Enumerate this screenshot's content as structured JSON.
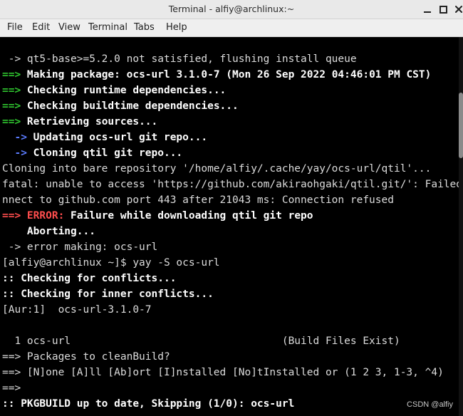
{
  "window": {
    "title": "Terminal - alfiy@archlinux:~"
  },
  "menu": [
    "File",
    "Edit",
    "View",
    "Terminal",
    "Tabs",
    "Help"
  ],
  "colors": {
    "arrow_green": "#2fc52f",
    "arrow_blue": "#5b7cff",
    "error_red": "#ff4d4d",
    "text": "#dcdcdc",
    "background": "#000000"
  },
  "terminal": {
    "lines": [
      {
        "segs": [
          {
            "t": " -> qt5-base>=5.2.0 not satisfied, flushing install queue",
            "c": ""
          }
        ]
      },
      {
        "segs": [
          {
            "t": "==>",
            "c": "g"
          },
          {
            "t": " Making package: ocs-url 3.1.0-7 (Mon 26 Sep 2022 04:46:01 PM CST)",
            "c": "w"
          }
        ]
      },
      {
        "segs": [
          {
            "t": "==>",
            "c": "g"
          },
          {
            "t": " Checking runtime dependencies...",
            "c": "w"
          }
        ]
      },
      {
        "segs": [
          {
            "t": "==>",
            "c": "g"
          },
          {
            "t": " Checking buildtime dependencies...",
            "c": "w"
          }
        ]
      },
      {
        "segs": [
          {
            "t": "==>",
            "c": "g"
          },
          {
            "t": " Retrieving sources...",
            "c": "w"
          }
        ]
      },
      {
        "segs": [
          {
            "t": "  ->",
            "c": "b"
          },
          {
            "t": " Updating ocs-url git repo...",
            "c": "w"
          }
        ]
      },
      {
        "segs": [
          {
            "t": "  ->",
            "c": "b"
          },
          {
            "t": " Cloning qtil git repo...",
            "c": "w"
          }
        ]
      },
      {
        "segs": [
          {
            "t": "Cloning into bare repository '/home/alfiy/.cache/yay/ocs-url/qtil'...",
            "c": ""
          }
        ]
      },
      {
        "segs": [
          {
            "t": "fatal: unable to access 'https://github.com/akiraohgaki/qtil.git/': Failed to co",
            "c": ""
          }
        ]
      },
      {
        "segs": [
          {
            "t": "nnect to github.com port 443 after 21043 ms: Connection refused",
            "c": ""
          }
        ]
      },
      {
        "segs": [
          {
            "t": "==>",
            "c": "r"
          },
          {
            "t": " ERROR:",
            "c": "r"
          },
          {
            "t": " Failure while downloading qtil git repo",
            "c": "w"
          }
        ]
      },
      {
        "segs": [
          {
            "t": "    Aborting...",
            "c": "w"
          }
        ]
      },
      {
        "segs": [
          {
            "t": " -> error making: ocs-url",
            "c": ""
          }
        ]
      },
      {
        "segs": [
          {
            "t": "[alfiy@archlinux ~]$ yay -S ocs-url",
            "c": ""
          }
        ]
      },
      {
        "segs": [
          {
            "t": ":: Checking for conflicts...",
            "c": "w"
          }
        ]
      },
      {
        "segs": [
          {
            "t": ":: Checking for inner conflicts...",
            "c": "w"
          }
        ]
      },
      {
        "segs": [
          {
            "t": "[Aur:1]  ocs-url-3.1.0-7",
            "c": ""
          }
        ]
      },
      {
        "segs": [
          {
            "t": "",
            "c": ""
          }
        ]
      },
      {
        "segs": [
          {
            "t": "  1 ocs-url                                  (Build Files Exist)",
            "c": ""
          }
        ]
      },
      {
        "segs": [
          {
            "t": "==> Packages to cleanBuild?",
            "c": ""
          }
        ]
      },
      {
        "segs": [
          {
            "t": "==> [N]one [A]ll [Ab]ort [I]nstalled [No]tInstalled or (1 2 3, 1-3, ^4)",
            "c": ""
          }
        ]
      },
      {
        "segs": [
          {
            "t": "==>",
            "c": ""
          }
        ]
      },
      {
        "segs": [
          {
            "t": ":: PKGBUILD up to date, Skipping (1/0): ocs-url",
            "c": "w"
          }
        ]
      }
    ]
  },
  "watermark": "CSDN @alfiy"
}
